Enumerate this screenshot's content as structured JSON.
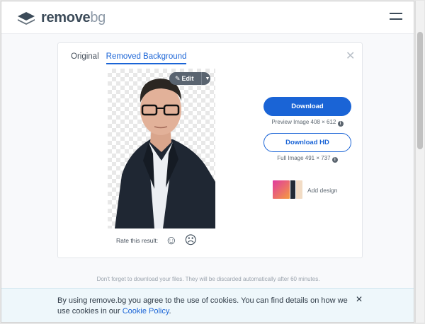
{
  "header": {
    "logo_remove": "remove",
    "logo_bg": "bg",
    "menu_icon": "hamburger-icon"
  },
  "card": {
    "tabs": [
      {
        "label": "Original",
        "active": false
      },
      {
        "label": "Removed Background",
        "active": true
      }
    ],
    "close_icon": "close-icon",
    "edit_label": "Edit",
    "rate_label": "Rate this result:",
    "rate_icons": [
      "smile-icon",
      "frown-icon"
    ],
    "download_label": "Download",
    "preview_info": "Preview Image 408 × 612",
    "download_hd_label": "Download HD",
    "full_info": "Full Image 491 × 737",
    "add_design_label": "Add design"
  },
  "reminder": "Don't forget to download your files. They will be discarded automatically after 60 minutes.",
  "cookie": {
    "text": "By using remove.bg you agree to the use of cookies. You can find details on how we use cookies in our ",
    "link": "Cookie Policy",
    "end": "."
  },
  "colors": {
    "accent": "#1a64d6",
    "brand_dark": "#3c4b59"
  }
}
